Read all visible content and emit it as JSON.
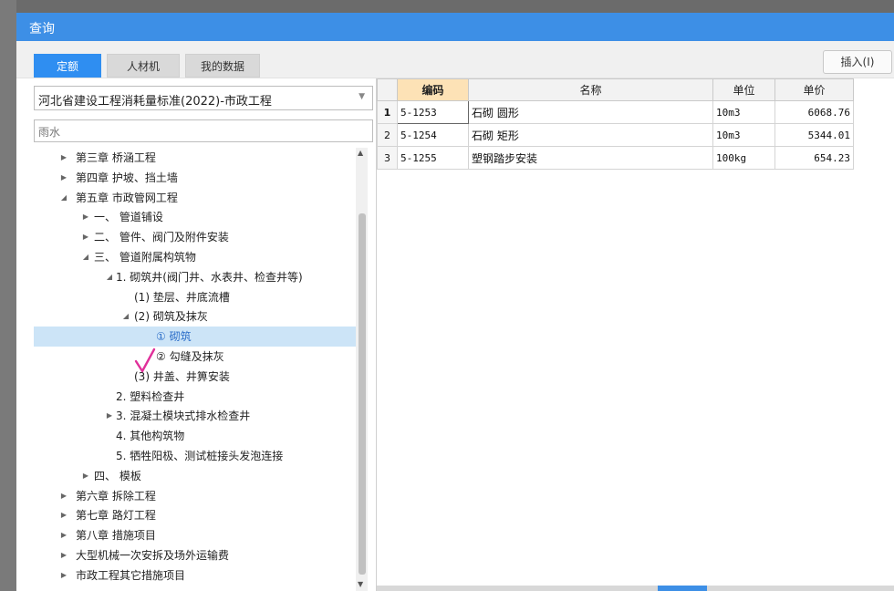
{
  "dialog": {
    "title": "查询"
  },
  "tabs": [
    {
      "label": "定额",
      "active": true
    },
    {
      "label": "人材机",
      "active": false
    },
    {
      "label": "我的数据",
      "active": false
    }
  ],
  "toolbar": {
    "insert_label": "插入(I)"
  },
  "standard_select": {
    "value": "河北省建设工程消耗量标准(2022)-市政工程"
  },
  "search": {
    "value": "雨水"
  },
  "tree": [
    {
      "label": "第三章 桥涵工程",
      "level": 0,
      "arrow": "collapsed"
    },
    {
      "label": "第四章 护坡、挡土墙",
      "level": 0,
      "arrow": "collapsed"
    },
    {
      "label": "第五章 市政管网工程",
      "level": 0,
      "arrow": "expanded"
    },
    {
      "label": "一、 管道铺设",
      "level": 1,
      "arrow": "collapsed"
    },
    {
      "label": "二、 管件、阀门及附件安装",
      "level": 1,
      "arrow": "collapsed"
    },
    {
      "label": "三、 管道附属构筑物",
      "level": 1,
      "arrow": "expanded"
    },
    {
      "label": "1. 砌筑井(阀门井、水表井、检查井等)",
      "level": 2,
      "arrow": "expanded"
    },
    {
      "label": "(1) 垫层、井底流槽",
      "level": 3,
      "arrow": "none"
    },
    {
      "label": "(2) 砌筑及抹灰",
      "level": 3,
      "arrow": "expanded"
    },
    {
      "label": "① 砌筑",
      "level": 4,
      "arrow": "none",
      "selected": true
    },
    {
      "label": "② 勾缝及抹灰",
      "level": 4,
      "arrow": "none"
    },
    {
      "label": "(3) 井盖、井箅安装",
      "level": 3,
      "arrow": "none"
    },
    {
      "label": "2. 塑料检查井",
      "level": 2,
      "arrow": "none"
    },
    {
      "label": "3. 混凝土模块式排水检查井",
      "level": 2,
      "arrow": "collapsed"
    },
    {
      "label": "4. 其他构筑物",
      "level": 2,
      "arrow": "none"
    },
    {
      "label": "5. 牺牲阳极、测试桩接头发泡连接",
      "level": 2,
      "arrow": "none"
    },
    {
      "label": "四、 模板",
      "level": 1,
      "arrow": "collapsed"
    },
    {
      "label": "第六章 拆除工程",
      "level": 0,
      "arrow": "collapsed"
    },
    {
      "label": "第七章 路灯工程",
      "level": 0,
      "arrow": "collapsed"
    },
    {
      "label": "第八章 措施项目",
      "level": 0,
      "arrow": "collapsed"
    },
    {
      "label": "大型机械一次安拆及场外运输费",
      "level": 0,
      "arrow": "collapsed"
    },
    {
      "label": "市政工程其它措施项目",
      "level": 0,
      "arrow": "collapsed"
    }
  ],
  "grid": {
    "columns": [
      "编码",
      "名称",
      "单位",
      "单价"
    ],
    "rows": [
      {
        "index": "1",
        "code": "5-1253",
        "name": "石砌 圆形",
        "unit": "10m3",
        "price": "6068.76"
      },
      {
        "index": "2",
        "code": "5-1254",
        "name": "石砌 矩形",
        "unit": "10m3",
        "price": "5344.01"
      },
      {
        "index": "3",
        "code": "5-1255",
        "name": "塑钢踏步安装",
        "unit": "100kg",
        "price": "654.23"
      }
    ]
  },
  "colors": {
    "accent": "#3d8fe6",
    "tab_active": "#2f8ef1",
    "selection": "#cce4f7",
    "check_mark": "#e0309a",
    "code_header": "#fde2b6"
  },
  "icons": {
    "collapsed": "triangle-right-icon",
    "expanded": "triangle-down-icon",
    "select_caret": "chevron-down-icon"
  }
}
